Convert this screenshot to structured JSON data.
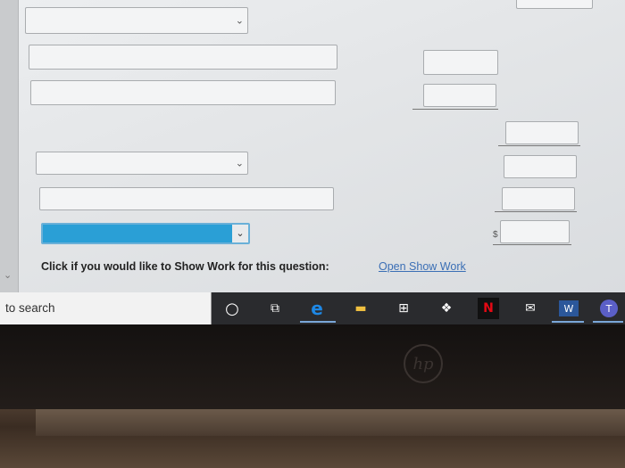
{
  "question": {
    "show_work_prompt": "Click if you would like to Show Work for this question:",
    "open_show_work_link": "Open Show Work",
    "currency_symbol": "$"
  },
  "taskbar": {
    "search_text": "to search",
    "icons": [
      {
        "name": "cortana-circle-icon",
        "glyph": "○"
      },
      {
        "name": "task-view-icon",
        "glyph": "⧉"
      },
      {
        "name": "edge-browser-icon",
        "glyph": "e",
        "color": "#1e88e5"
      },
      {
        "name": "file-explorer-icon",
        "glyph": "▬",
        "color": "#f0c040"
      },
      {
        "name": "store-icon",
        "glyph": "⊞"
      },
      {
        "name": "dropbox-icon",
        "glyph": "❖"
      },
      {
        "name": "netflix-icon",
        "glyph": "N",
        "color": "#e50914"
      },
      {
        "name": "mail-icon",
        "glyph": "✉"
      },
      {
        "name": "word-icon",
        "glyph": "W",
        "color": "#2b579a"
      },
      {
        "name": "teams-icon",
        "glyph": "T",
        "color": "#5b5fc7"
      }
    ]
  },
  "device": {
    "logo_text": "hp"
  },
  "colors": {
    "active_select": "#2a9fd6",
    "link": "#3b6fb5"
  }
}
